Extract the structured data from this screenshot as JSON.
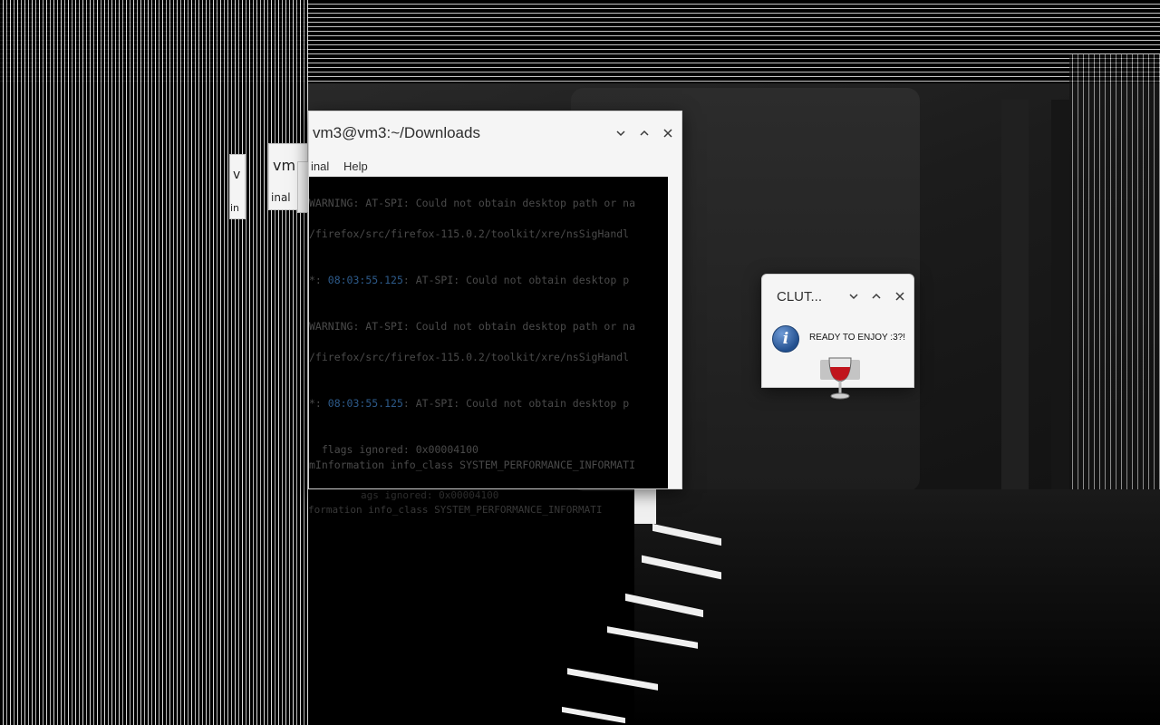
{
  "terminal": {
    "title": "vm3@vm3:~/Downloads",
    "menu": [
      "inal",
      "Help"
    ],
    "lines": [
      {
        "pre": "",
        "ts": "",
        "text": "WARNING: AT-SPI: Could not obtain desktop path or na"
      },
      {
        "pre": "",
        "ts": "",
        "text": "/firefox/src/firefox-115.0.2/toolkit/xre/nsSigHandl"
      },
      {
        "pre": "*: ",
        "ts": "08:03:55.125",
        "text": ": AT-SPI: Could not obtain desktop p"
      },
      {
        "pre": "",
        "ts": "",
        "text": "WARNING: AT-SPI: Could not obtain desktop path or na"
      },
      {
        "pre": "",
        "ts": "",
        "text": "/firefox/src/firefox-115.0.2/toolkit/xre/nsSigHandl"
      },
      {
        "pre": "*: ",
        "ts": "08:03:55.125",
        "text": ": AT-SPI: Could not obtain desktop p"
      },
      {
        "pre": "",
        "ts": "",
        "text": "  flags ignored: 0x00004100"
      },
      {
        "pre": "",
        "ts": "",
        "text": "mInformation info_class SYSTEM_PERFORMANCE_INFORMATI"
      }
    ],
    "bleed": [
      "ags ignored: 0x00004100",
      "formation info_class SYSTEM_PERFORMANCE_INFORMATI"
    ]
  },
  "ghost_tabs": [
    "vm",
    "inal",
    "v",
    "in"
  ],
  "dialog": {
    "title": "CLUT...",
    "message": "READY TO ENJOY :3?!",
    "icon": "info-icon",
    "app_icon": "wine-glass-icon"
  },
  "colors": {
    "window_bg": "#f5f5f5",
    "terminal_bg": "#000000",
    "terminal_text": "#4a4a4a",
    "timestamp": "#2d5a8a",
    "info_icon": "#23508f",
    "wine": "#c0141c"
  }
}
